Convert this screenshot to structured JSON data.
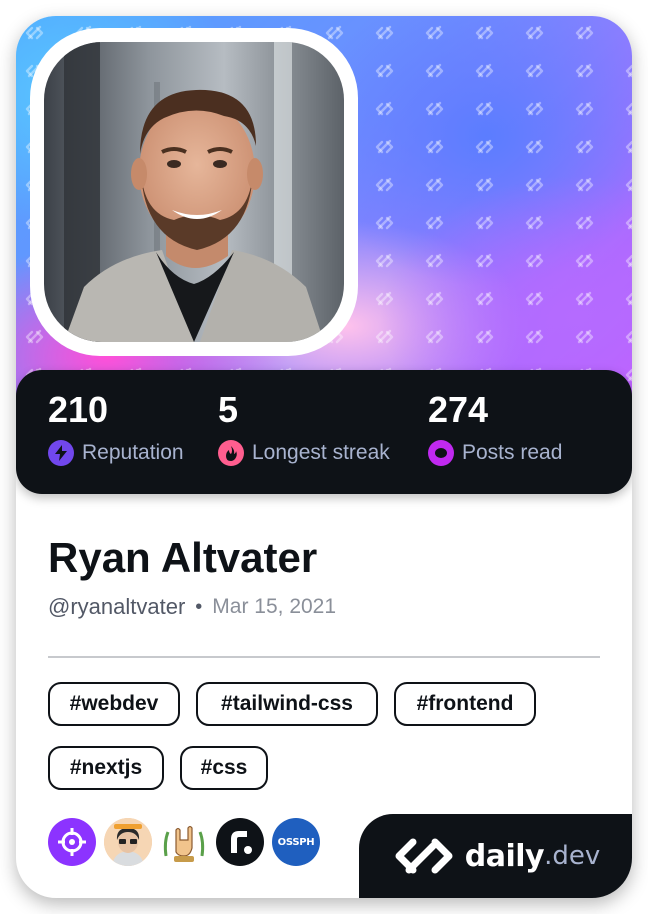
{
  "stats": [
    {
      "value": "210",
      "label": "Reputation",
      "icon": "lightning-icon",
      "color": "#7147ed"
    },
    {
      "value": "5",
      "label": "Longest streak",
      "icon": "flame-icon",
      "color": "#ff5e8f"
    },
    {
      "value": "274",
      "label": "Posts read",
      "icon": "eye-ring-icon",
      "color": "#c029f0"
    }
  ],
  "profile": {
    "name": "Ryan Altvater",
    "handle": "@ryanaltvater",
    "separator": "•",
    "joined": "Mar 15, 2021"
  },
  "tags": [
    "#webdev",
    "#tailwind-css",
    "#frontend",
    "#nextjs",
    "#css"
  ],
  "badges": [
    {
      "icon": "target-icon",
      "color": "#8c33ff"
    },
    {
      "icon": "avatar-icon",
      "color": "#f2c9a0"
    },
    {
      "icon": "rock-hand-icon",
      "color": "#ffffff"
    },
    {
      "icon": "r-logo-icon",
      "color": "#0e1217"
    },
    {
      "label": "OSSPH",
      "icon": "ossph-icon",
      "color": "#1f5fbf"
    }
  ],
  "brand": {
    "name": "daily",
    "tld": ".dev"
  }
}
